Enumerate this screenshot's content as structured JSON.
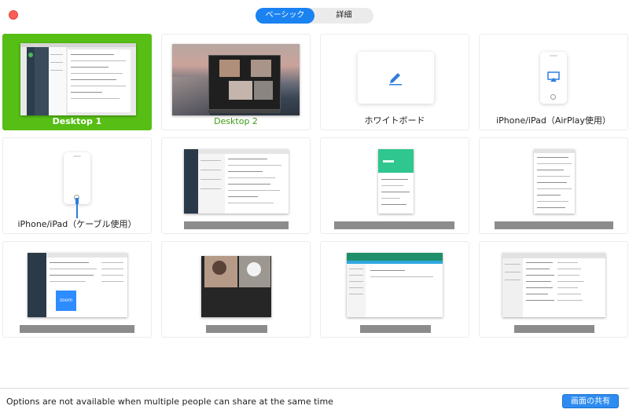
{
  "tabs": [
    {
      "label": "ベーシック",
      "active": true
    },
    {
      "label": "詳細",
      "active": false
    }
  ],
  "tiles": [
    {
      "label": "Desktop 1",
      "selected": true
    },
    {
      "label": "Desktop 2",
      "selected": false
    },
    {
      "label": "ホワイトボード",
      "selected": false
    },
    {
      "label": "iPhone/iPad（AirPlay使用）",
      "selected": false
    },
    {
      "label": "iPhone/iPad（ケーブル使用）",
      "selected": false
    }
  ],
  "window_thumb_text": {
    "zoom_logo": "zoom"
  },
  "icons": {
    "close": "close-icon",
    "pen": "pen-icon",
    "airplay": "airplay-icon",
    "cable": "lightning-cable-icon"
  },
  "colors": {
    "accent_blue": "#1a82f1",
    "selected_green": "#56be14",
    "label_green": "#3f9b18",
    "close_red": "#fc5f57"
  },
  "footer": {
    "message": "Options are not available when multiple people can share at the same time",
    "share_button": "画面の共有"
  }
}
